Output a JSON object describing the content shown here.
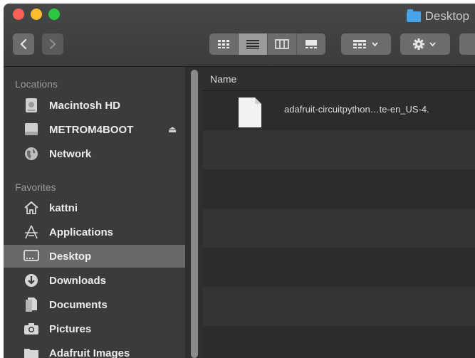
{
  "window": {
    "title": "Desktop"
  },
  "toolbar": {
    "back_icon": "chevron-left",
    "forward_icon": "chevron-right",
    "views": [
      "icon-view",
      "list-view",
      "column-view",
      "gallery-view"
    ],
    "active_view": "list-view",
    "group_icon": "grid-dropdown",
    "action_icon": "gear-dropdown"
  },
  "sidebar": {
    "locations_header": "Locations",
    "locations": [
      {
        "label": "Macintosh HD",
        "icon": "hard-drive"
      },
      {
        "label": "METROM4BOOT",
        "icon": "external-drive",
        "eject": "⏏"
      },
      {
        "label": "Network",
        "icon": "network-globe"
      }
    ],
    "favorites_header": "Favorites",
    "favorites": [
      {
        "label": "kattni",
        "icon": "home"
      },
      {
        "label": "Applications",
        "icon": "applications"
      },
      {
        "label": "Desktop",
        "icon": "desktop",
        "selected": true
      },
      {
        "label": "Downloads",
        "icon": "downloads"
      },
      {
        "label": "Documents",
        "icon": "documents"
      },
      {
        "label": "Pictures",
        "icon": "pictures"
      },
      {
        "label": "Adafruit Images",
        "icon": "folder"
      }
    ]
  },
  "file_list": {
    "column_name": "Name",
    "files": [
      {
        "name": "adafruit-circuitpython…te-en_US-4.",
        "icon": "document"
      }
    ]
  },
  "colors": {
    "sidebar_bg": "#3a3b3b",
    "selected_bg": "#686969",
    "list_bg": "#2b2c2c",
    "list_alt_bg": "#333434"
  }
}
